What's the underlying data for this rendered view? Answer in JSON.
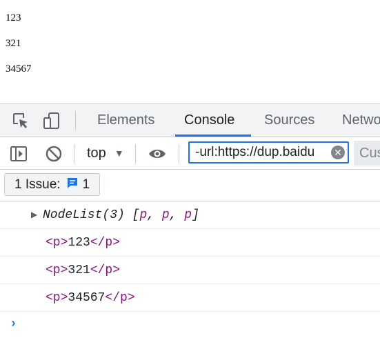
{
  "page": {
    "lines": [
      "123",
      "321",
      "34567"
    ]
  },
  "devtools": {
    "tabs": [
      {
        "label": "Elements"
      },
      {
        "label": "Console"
      },
      {
        "label": "Sources"
      },
      {
        "label": "Netwo"
      }
    ],
    "active_tab": "Console",
    "toolbar": {
      "context": "top",
      "filter_value": "-url:https://dup.baidu",
      "custom_label": "Cus"
    },
    "issues": {
      "label": "1 Issue:",
      "count": "1"
    },
    "console": {
      "nodelist": {
        "prefix": "NodeList(3) [",
        "items": [
          "p",
          "p",
          "p"
        ],
        "suffix": "]"
      },
      "elements": [
        {
          "open": "<p>",
          "text": "123",
          "close": "</p>"
        },
        {
          "open": "<p>",
          "text": "321",
          "close": "</p>"
        },
        {
          "open": "<p>",
          "text": "34567",
          "close": "</p>"
        }
      ],
      "prompt": "›"
    },
    "colors": {
      "accent": "#1a73e8",
      "tag": "#881280",
      "toolbar_bg": "#f1f3f4"
    }
  }
}
